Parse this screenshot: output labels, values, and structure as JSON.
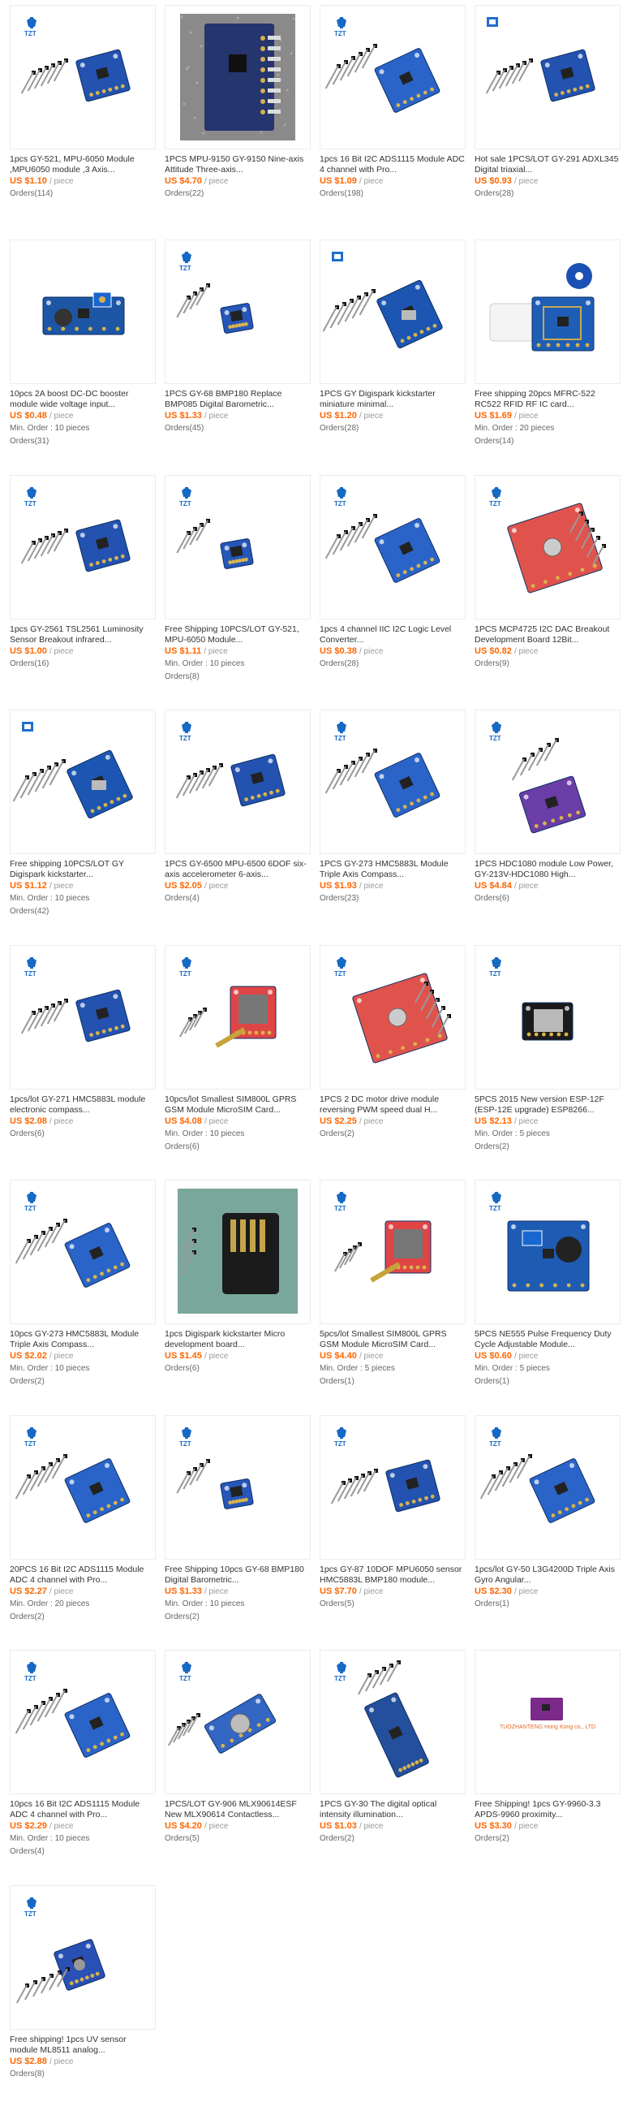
{
  "price_unit": "/ piece",
  "products": [
    {
      "title": "1pcs GY-521, MPU-6050 Module ,MPU6050 module ,3 Axis...",
      "price": "US $1.10",
      "min_order": "",
      "orders": "Orders(114)",
      "logo": "tzt",
      "img": "a"
    },
    {
      "title": "1PCS MPU-9150 GY-9150 Nine-axis Attitude Three-axis...",
      "price": "US $4.70",
      "min_order": "",
      "orders": "Orders(22)",
      "logo": "",
      "img": "photo"
    },
    {
      "title": "1pcs 16 Bit I2C ADS1115 Module ADC 4 channel with Pro...",
      "price": "US $1.09",
      "min_order": "",
      "orders": "Orders(198)",
      "logo": "tzt",
      "img": "b"
    },
    {
      "title": "Hot sale 1PCS/LOT GY-291 ADXL345 Digital triaxial...",
      "price": "US $0.93",
      "min_order": "",
      "orders": "Orders(28)",
      "logo": "badge",
      "img": "a"
    },
    {
      "title": "10pcs 2A boost DC-DC booster module wide voltage input...",
      "price": "US $0.48",
      "min_order": "Min. Order : 10 pieces",
      "orders": "Orders(31)",
      "logo": "",
      "img": "boost"
    },
    {
      "title": "1PCS GY-68 BMP180 Replace BMP085 Digital Barometric...",
      "price": "US $1.33",
      "min_order": "",
      "orders": "Orders(45)",
      "logo": "tzt",
      "img": "small"
    },
    {
      "title": "1PCS GY Digispark kickstarter miniature minimal...",
      "price": "US $1.20",
      "min_order": "",
      "orders": "Orders(28)",
      "logo": "badge",
      "img": "digi"
    },
    {
      "title": "Free shipping 20pcs MFRC-522 RC522 RFID RF IC card...",
      "price": "US $1.69",
      "min_order": "Min. Order : 20 pieces",
      "orders": "Orders(14)",
      "logo": "",
      "img": "rfid"
    },
    {
      "title": "1pcs GY-2561 TSL2561 Luminosity Sensor Breakout infrared...",
      "price": "US $1.00",
      "min_order": "",
      "orders": "Orders(16)",
      "logo": "tzt",
      "img": "a"
    },
    {
      "title": "Free Shipping 10PCS/LOT GY-521, MPU-6050 Module...",
      "price": "US $1.11",
      "min_order": "Min. Order : 10 pieces",
      "orders": "Orders(8)",
      "logo": "tzt",
      "img": "small"
    },
    {
      "title": "1pcs 4 channel IIC I2C Logic Level Converter...",
      "price": "US $0.38",
      "min_order": "",
      "orders": "Orders(28)",
      "logo": "tzt",
      "img": "b"
    },
    {
      "title": "1PCS MCP4725 I2C DAC Breakout Development Board 12Bit...",
      "price": "US $0.82",
      "min_order": "",
      "orders": "Orders(9)",
      "logo": "tzt",
      "img": "red"
    },
    {
      "title": "Free shipping 10PCS/LOT GY Digispark kickstarter...",
      "price": "US $1.12",
      "min_order": "Min. Order : 10 pieces",
      "orders": "Orders(42)",
      "logo": "badge",
      "img": "digi"
    },
    {
      "title": "1PCS GY-6500 MPU-6500 6DOF six-axis accelerometer 6-axis...",
      "price": "US $2.05",
      "min_order": "",
      "orders": "Orders(4)",
      "logo": "tzt",
      "img": "a"
    },
    {
      "title": "1PCS GY-273 HMC5883L Module Triple Axis Compass...",
      "price": "US $1.93",
      "min_order": "",
      "orders": "Orders(23)",
      "logo": "tzt",
      "img": "b"
    },
    {
      "title": "1PCS HDC1080 module Low Power, GY-213V-HDC1080 High...",
      "price": "US $4.84",
      "min_order": "",
      "orders": "Orders(6)",
      "logo": "tzt",
      "img": "purple"
    },
    {
      "title": "1pcs/lot GY-271 HMC5883L module electronic compass...",
      "price": "US $2.08",
      "min_order": "",
      "orders": "Orders(6)",
      "logo": "tzt",
      "img": "a"
    },
    {
      "title": "10pcs/lot Smallest SIM800L GPRS GSM Module MicroSIM Card...",
      "price": "US $4.08",
      "min_order": "Min. Order : 10 pieces",
      "orders": "Orders(6)",
      "logo": "tzt",
      "img": "gsm"
    },
    {
      "title": "1PCS 2 DC motor drive module reversing PWM speed dual H...",
      "price": "US $2.25",
      "min_order": "",
      "orders": "Orders(2)",
      "logo": "tzt",
      "img": "red"
    },
    {
      "title": "5PCS 2015 New version ESP-12F (ESP-12E upgrade) ESP8266...",
      "price": "US $2.13",
      "min_order": "Min. Order : 5 pieces",
      "orders": "Orders(2)",
      "logo": "tzt",
      "img": "esp"
    },
    {
      "title": "10pcs GY-273 HMC5883L Module Triple Axis Compass...",
      "price": "US $2.02",
      "min_order": "Min. Order : 10 pieces",
      "orders": "Orders(2)",
      "logo": "tzt",
      "img": "b"
    },
    {
      "title": "1pcs Digispark kickstarter Micro development board...",
      "price": "US $1.45",
      "min_order": "",
      "orders": "Orders(6)",
      "logo": "",
      "img": "photo2"
    },
    {
      "title": "5pcs/lot Smallest SIM800L GPRS GSM Module MicroSIM Card...",
      "price": "US $4.40",
      "min_order": "Min. Order : 5 pieces",
      "orders": "Orders(1)",
      "logo": "tzt",
      "img": "gsm"
    },
    {
      "title": "5PCS NE555 Pulse Frequency Duty Cycle Adjustable Module...",
      "price": "US $0.60",
      "min_order": "Min. Order : 5 pieces",
      "orders": "Orders(1)",
      "logo": "tzt",
      "img": "ne555"
    },
    {
      "title": "20PCS 16 Bit I2C ADS1115 Module ADC 4 channel with Pro...",
      "price": "US $2.27",
      "min_order": "Min. Order : 20 pieces",
      "orders": "Orders(2)",
      "logo": "tzt",
      "img": "b"
    },
    {
      "title": "Free Shipping 10pcs GY-68 BMP180 Digital Barometric...",
      "price": "US $1.33",
      "min_order": "Min. Order : 10 pieces",
      "orders": "Orders(2)",
      "logo": "tzt",
      "img": "small"
    },
    {
      "title": "1pcs GY-87 10DOF MPU6050 sensor HMC5883L BMP180 module...",
      "price": "US $7.70",
      "min_order": "",
      "orders": "Orders(5)",
      "logo": "tzt",
      "img": "a"
    },
    {
      "title": "1pcs/lot GY-50 L3G4200D Triple Axis Gyro Angular...",
      "price": "US $2.30",
      "min_order": "",
      "orders": "Orders(1)",
      "logo": "tzt",
      "img": "b"
    },
    {
      "title": "10pcs 16 Bit I2C ADS1115 Module ADC 4 channel with Pro...",
      "price": "US $2.29",
      "min_order": "Min. Order : 10 pieces",
      "orders": "Orders(4)",
      "logo": "tzt",
      "img": "b"
    },
    {
      "title": "1PCS/LOT GY-906 MLX90614ESF New MLX90614 Contactless...",
      "price": "US $4.20",
      "min_order": "",
      "orders": "Orders(5)",
      "logo": "tzt",
      "img": "mlx"
    },
    {
      "title": "1PCS GY-30 The digital optical intensity illumination...",
      "price": "US $1.03",
      "min_order": "",
      "orders": "Orders(2)",
      "logo": "tzt",
      "img": "gy30"
    },
    {
      "title": "Free Shipping! 1pcs GY-9960-3.3 APDS-9960 proximity...",
      "price": "US $3.30",
      "min_order": "",
      "orders": "Orders(2)",
      "logo": "",
      "img": "apds",
      "watermark": "TUOZHANTENG Hong Kong co., LTD"
    },
    {
      "title": "Free shipping! 1pcs UV sensor module ML8511 analog...",
      "price": "US $2.88",
      "min_order": "",
      "orders": "Orders(8)",
      "logo": "tzt",
      "img": "uv"
    }
  ],
  "logo_text": "TZT"
}
